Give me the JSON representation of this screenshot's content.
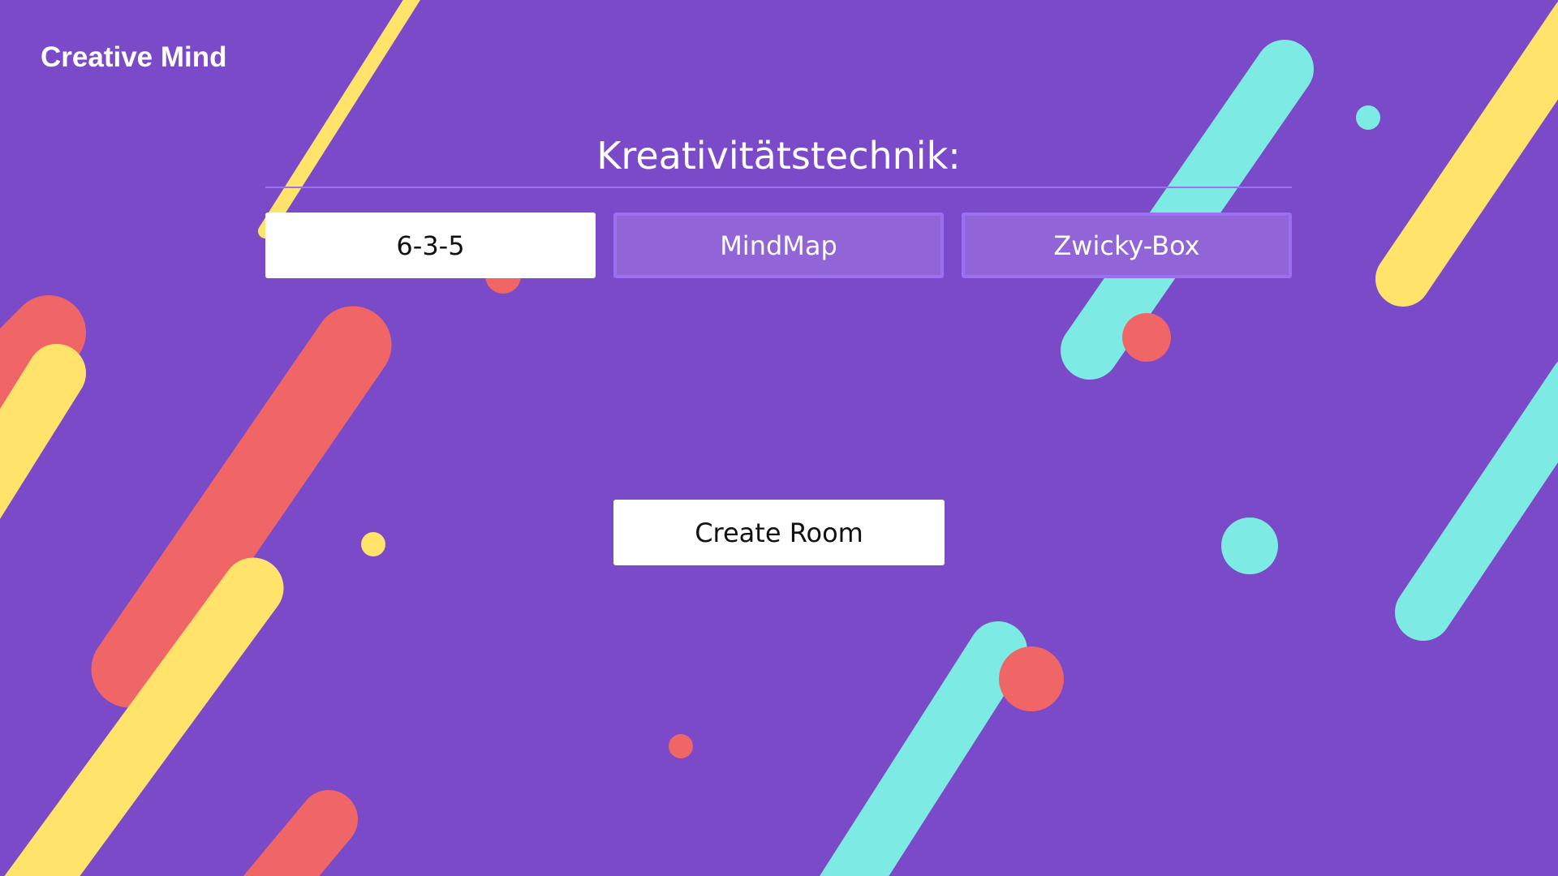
{
  "app": {
    "brand": "Creative Mind"
  },
  "technique": {
    "heading": "Kreativitätstechnik:",
    "options": [
      {
        "label": "6-3-5",
        "selected": true
      },
      {
        "label": "MindMap",
        "selected": false
      },
      {
        "label": "Zwicky-Box",
        "selected": false
      }
    ]
  },
  "actions": {
    "create_room_label": "Create Room"
  },
  "colors": {
    "background": "#7a4ac9",
    "yellow": "#ffe36a",
    "red": "#f06666",
    "cyan": "#7deae3",
    "tab_inactive": "#9164d8",
    "tab_border": "#9b6ff1",
    "divider": "#9d70f0"
  }
}
